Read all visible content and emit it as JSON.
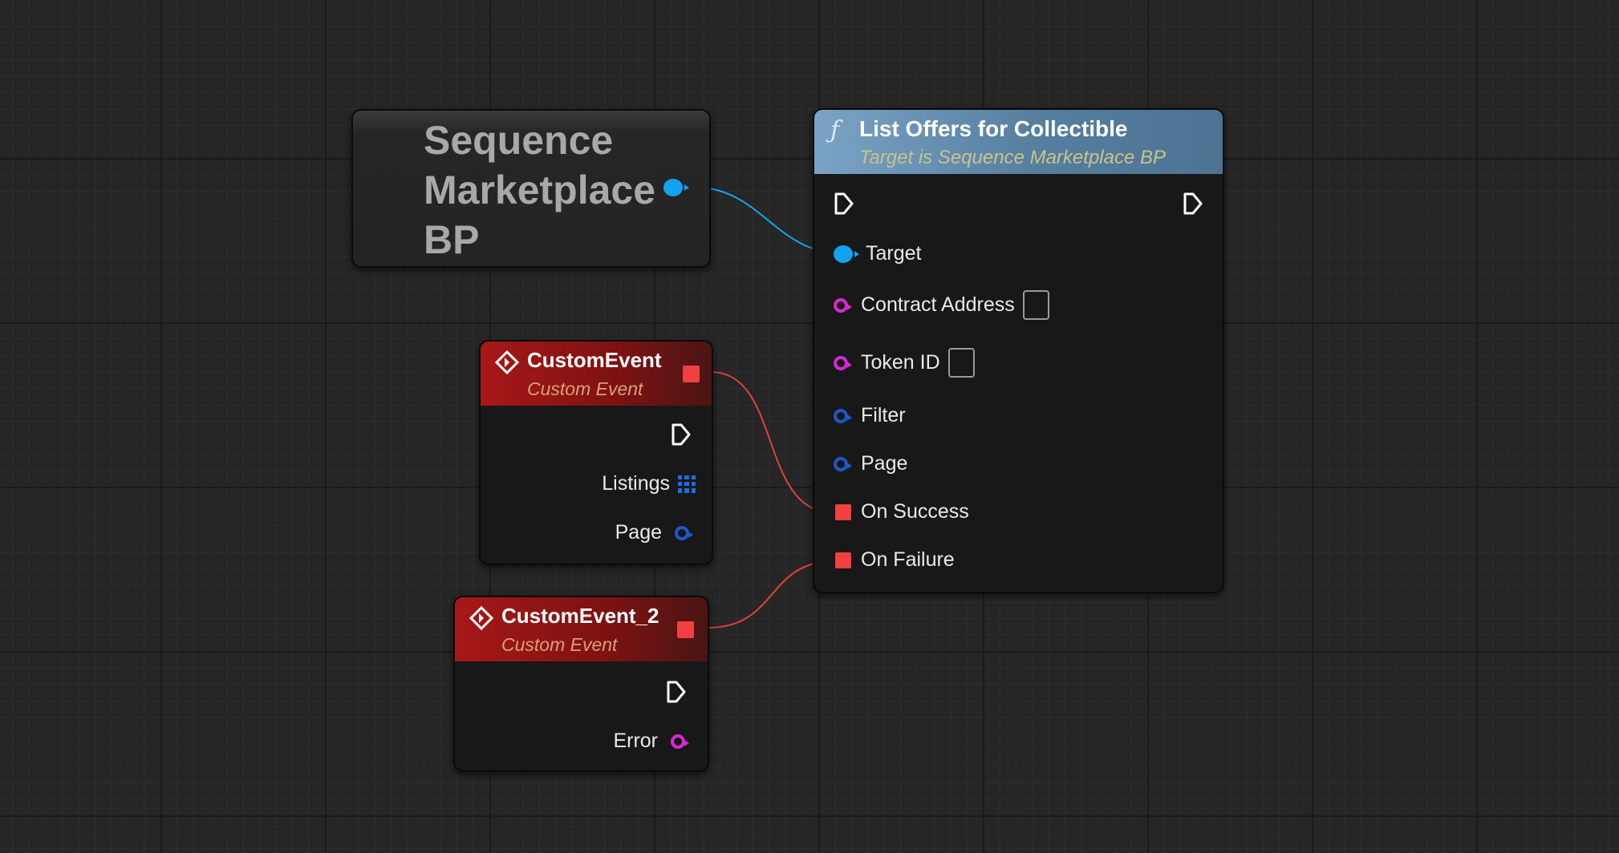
{
  "colors": {
    "background": "#262626",
    "object_pin": "#12a3f0",
    "string_pin": "#d629d0",
    "struct_pin": "#1e58c8",
    "event_pin": "#f04040",
    "function_header": "#5a86ac",
    "event_header": "#9b1515"
  },
  "nodes": {
    "marketplace_ref": {
      "title": "Sequence Marketplace BP"
    },
    "list_offers": {
      "icon": "function-icon",
      "icon_glyph": "ƒ",
      "title": "List Offers for Collectible",
      "subtitle": "Target is Sequence Marketplace BP",
      "pins": {
        "target": "Target",
        "contract_address": "Contract Address",
        "token_id": "Token ID",
        "filter": "Filter",
        "page": "Page",
        "on_success": "On Success",
        "on_failure": "On Failure"
      }
    },
    "custom_event": {
      "icon": "event-diamond-icon",
      "title": "CustomEvent",
      "subtitle": "Custom Event",
      "pins": {
        "listings": "Listings",
        "page": "Page"
      }
    },
    "custom_event_2": {
      "icon": "event-diamond-icon",
      "title": "CustomEvent_2",
      "subtitle": "Custom Event",
      "pins": {
        "error": "Error"
      }
    }
  }
}
